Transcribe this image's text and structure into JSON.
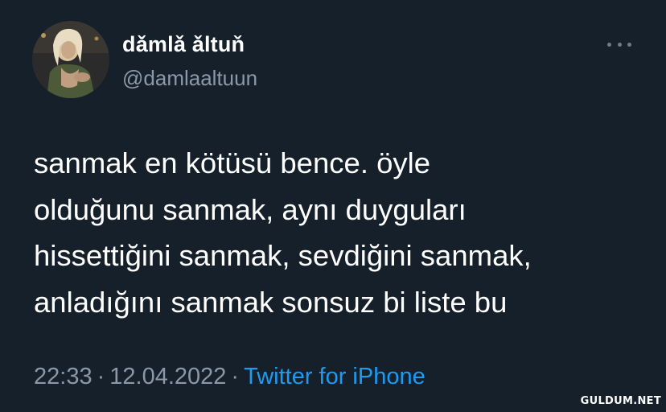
{
  "user": {
    "display_name": "dǎmlǎ ǎltuň",
    "handle": "@damlaaltuun",
    "avatar_icon": "profile-photo"
  },
  "tweet": {
    "lines": [
      "sanmak en kötüsü bence. öyle",
      "olduğunu sanmak, aynı duyguları",
      "hissettiğini sanmak, sevdiğini sanmak,",
      "anladığını sanmak sonsuz bi liste bu"
    ]
  },
  "meta": {
    "time": "22:33",
    "separator": "·",
    "date": "12.04.2022",
    "source": "Twitter for iPhone"
  },
  "watermark": "GULDUM.NET",
  "colors": {
    "background": "#15202b",
    "text_primary": "#ffffff",
    "text_secondary": "#8b98a5",
    "link": "#1d9bf0"
  }
}
